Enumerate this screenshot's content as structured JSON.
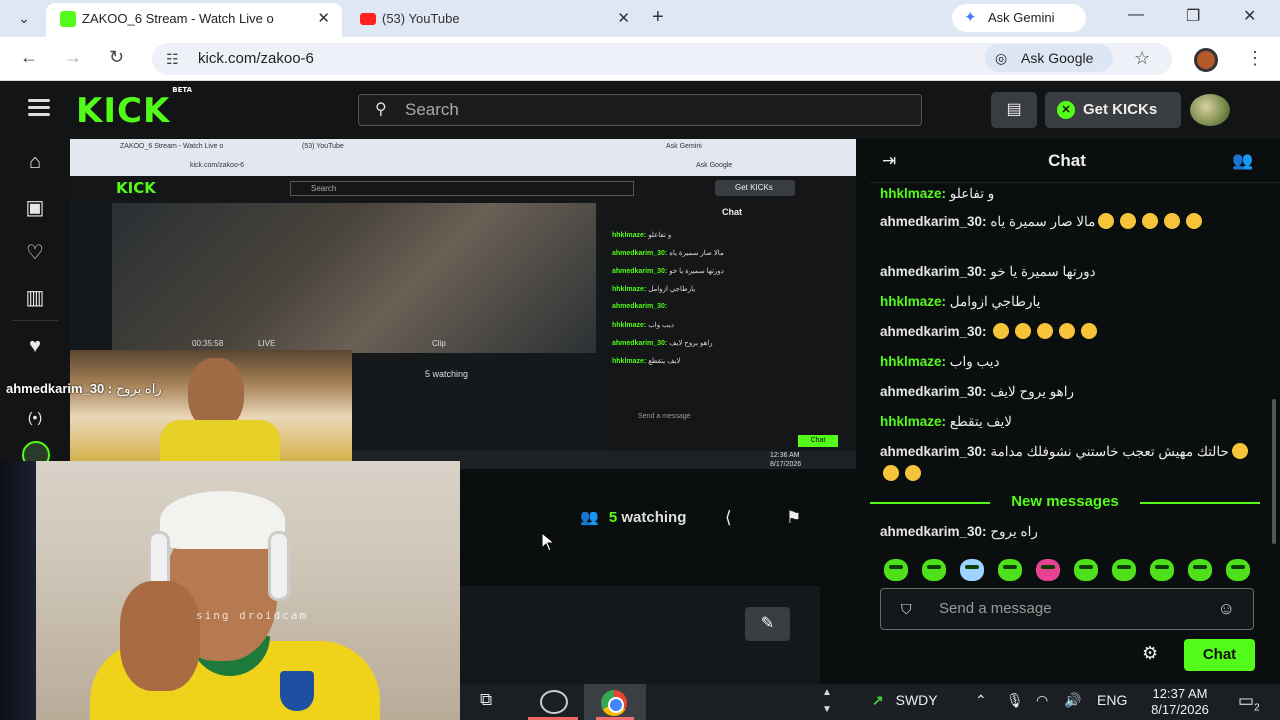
{
  "browser": {
    "tabs": [
      {
        "title": "ZAKOO_6 Stream - Watch Live o",
        "active": true
      },
      {
        "title": "(53) YouTube",
        "active": false
      }
    ],
    "ask_gemini": "Ask Gemini",
    "url": "kick.com/zakoo-6",
    "ask_google": "Ask Google"
  },
  "kick": {
    "logo": "KICK",
    "logo_badge": "BETA",
    "search_placeholder": "Search",
    "get_kicks": "Get KICKs"
  },
  "stream": {
    "overlay_name": "ahmedkarim_30 :",
    "overlay_text": "راه يروح",
    "watching_count": "5",
    "watching_label": "watching",
    "watermark": "sing droidcam"
  },
  "inner": {
    "tab1": "ZAKOO_6 Stream - Watch Live o",
    "tab2": "(53) YouTube",
    "url": "kick.com/zakoo-6",
    "gemini": "Ask Gemini",
    "google": "Ask Google",
    "search": "Search",
    "kicks": "Get KICKs",
    "chat": "Chat",
    "time": "00:35:58",
    "live": "LIVE",
    "clip": "Clip",
    "watching": "5 watching",
    "send": "Send a message",
    "chat_btn": "Chat",
    "clock_time": "12:36 AM",
    "clock_date": "8/17/2026",
    "lines": [
      {
        "user": "hhklmaze:",
        "text": "و تفاعلو"
      },
      {
        "user": "ahmedkarim_30:",
        "text": "مالا صار سميرة ياه"
      },
      {
        "user": "ahmedkarim_30:",
        "text": "دورتها سميرة يا خو"
      },
      {
        "user": "hhklmaze:",
        "text": "يارطاجي ازوامل"
      },
      {
        "user": "ahmedkarim_30:",
        "text": ""
      },
      {
        "user": "hhklmaze:",
        "text": "ديب واب"
      },
      {
        "user": "ahmedkarim_30:",
        "text": "راهو يروح لايف"
      },
      {
        "user": "hhklmaze:",
        "text": "لايف يتقطع"
      }
    ]
  },
  "chat": {
    "title": "Chat",
    "messages": [
      {
        "user": "hhklmaze:",
        "text": "و تفاعلو",
        "color": "#53fc18",
        "emojis": 0
      },
      {
        "user": "ahmedkarim_30:",
        "text": "مالا صار سميرة ياه",
        "color": "#e6e6e6",
        "emojis": 5
      },
      {
        "user": "ahmedkarim_30:",
        "text": "دورتها سميرة يا خو",
        "color": "#e6e6e6",
        "emojis": 0
      },
      {
        "user": "hhklmaze:",
        "text": "يارطاجي ازوامل",
        "color": "#53fc18",
        "emojis": 0
      },
      {
        "user": "ahmedkarim_30:",
        "text": "",
        "color": "#e6e6e6",
        "emojis": 5
      },
      {
        "user": "hhklmaze:",
        "text": "ديب واب",
        "color": "#53fc18",
        "emojis": 0
      },
      {
        "user": "ahmedkarim_30:",
        "text": "راهو يروح لايف",
        "color": "#e6e6e6",
        "emojis": 0
      },
      {
        "user": "hhklmaze:",
        "text": "لايف يتقطع",
        "color": "#53fc18",
        "emojis": 0
      },
      {
        "user": "ahmedkarim_30:",
        "text": "حالتك مهيش تعجب خاستني نشوفلك مدامة",
        "color": "#e6e6e6",
        "emojis": 3
      }
    ],
    "new_messages": "New messages",
    "latest": {
      "user": "ahmedkarim_30:",
      "text": "راه يروح"
    },
    "input_placeholder": "Send a message",
    "send_label": "Chat"
  },
  "taskbar": {
    "stock": "SWDY",
    "language": "ENG",
    "time": "12:37 AM",
    "date": "8/17/2026",
    "notifications": "2"
  },
  "colors": {
    "accent": "#53fc18",
    "background": "#0b0e0f"
  }
}
